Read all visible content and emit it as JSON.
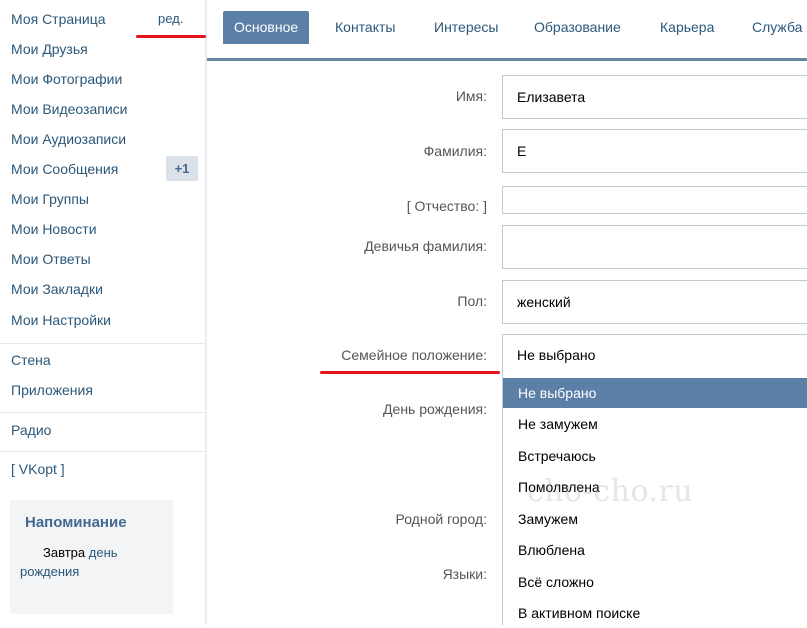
{
  "sidebar": {
    "my_page": "Моя Страница",
    "edit_link": "ред.",
    "items": [
      "Мои Друзья",
      "Мои Фотографии",
      "Мои Видеозаписи",
      "Мои Аудиозаписи",
      "Мои Сообщения",
      "Мои Группы",
      "Мои Новости",
      "Мои Ответы",
      "Мои Закладки",
      "Мои Настройки"
    ],
    "messages_badge": "+1",
    "extra": [
      "Стена",
      "Приложения",
      "Радио",
      "[ VKopt ]"
    ],
    "reminder": {
      "title": "Напоминание",
      "prefix": "Завтра",
      "link": "день рождения"
    }
  },
  "tabs": [
    "Основное",
    "Контакты",
    "Интересы",
    "Образование",
    "Карьера",
    "Служба"
  ],
  "form": {
    "first_name_label": "Имя:",
    "first_name_value": "Елизавета",
    "last_name_label": "Фамилия:",
    "last_name_value": "Е",
    "patronymic_label": "[ Отчество: ]",
    "patronymic_value": "",
    "maiden_label": "Девичья фамилия:",
    "maiden_value": "",
    "gender_label": "Пол:",
    "gender_value": "женский",
    "marital_label": "Семейное положение:",
    "marital_value": "Не выбрано",
    "birthday_label": "День рождения:",
    "hometown_label": "Родной город:",
    "languages_label": "Языки:"
  },
  "marital_options": [
    "Не выбрано",
    "Не замужем",
    "Встречаюсь",
    "Помолвлена",
    "Замужем",
    "Влюблена",
    "Всё сложно",
    "В активном поиске"
  ],
  "watermark": "cho-cho.ru",
  "colors": {
    "accent": "#5b7fa6",
    "link": "#2b587a",
    "highlight_underline": "#e8141b"
  }
}
